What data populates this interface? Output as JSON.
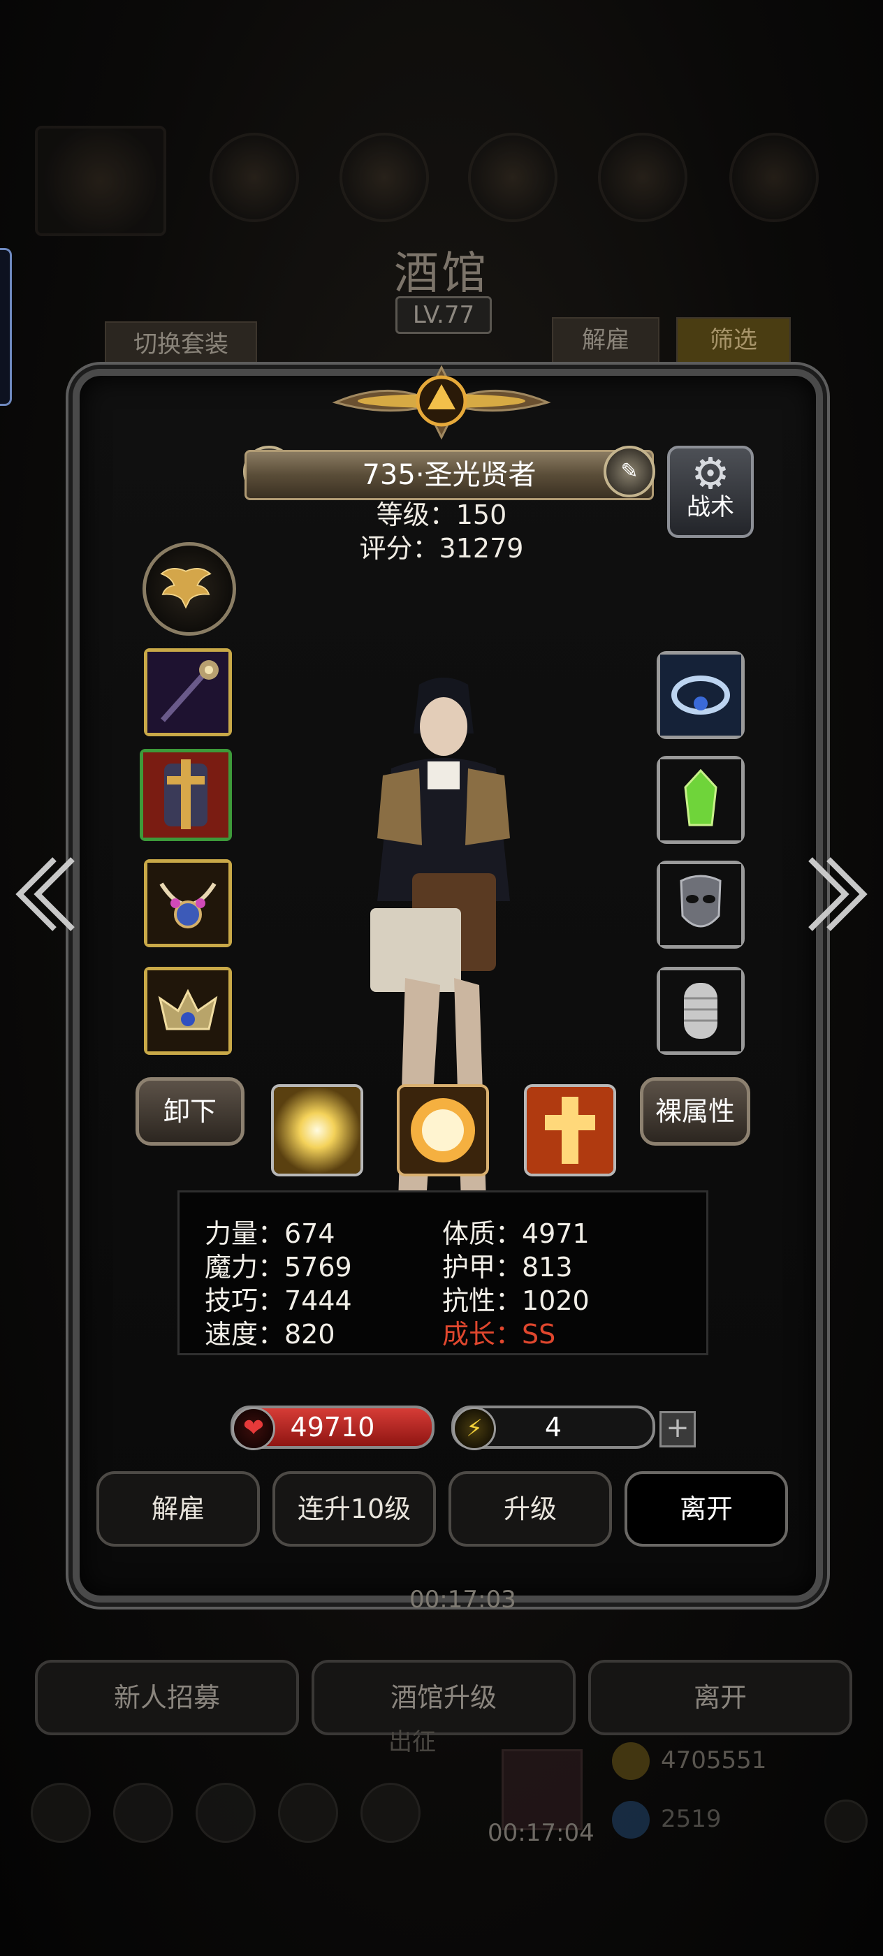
{
  "background": {
    "title": "酒馆",
    "level": "LV.77",
    "tab_switch": "切换套装",
    "tab_dismiss": "解雇",
    "tab_filter": "筛选",
    "timer_top": "00:17:03",
    "bottom_buttons": [
      "新人招募",
      "酒馆升级",
      "离开"
    ],
    "expedition": "出征",
    "timer_bottom": "00:17:04",
    "gold": "4705551",
    "gems": "2519"
  },
  "hero": {
    "name": "735·圣光贤者",
    "level_text": "等级：150",
    "score_text": "评分：31279",
    "tactics_label": "战术",
    "unequip_label": "卸下",
    "base_attr_label": "裸属性"
  },
  "stats": {
    "strength": "力量：674",
    "magic": "魔力：5769",
    "skill": "技巧：7444",
    "speed": "速度：820",
    "constitution": "体质：4971",
    "armor": "护甲：813",
    "resistance": "抗性：1020",
    "growth": "成长：SS"
  },
  "resources": {
    "hp": "49710",
    "energy": "4",
    "plus": "+"
  },
  "actions": {
    "dismiss": "解雇",
    "level_up_10": "连升10级",
    "level_up": "升级",
    "leave": "离开"
  },
  "icons": {
    "left_slots": [
      "staff-icon",
      "holy-armor-icon",
      "jeweled-necklace-icon",
      "winged-crown-icon"
    ],
    "right_slots": [
      "blue-ring-icon",
      "green-crystal-icon",
      "mask-icon",
      "chainmail-icon"
    ],
    "skills": [
      "golden-burst-icon",
      "holy-orb-icon",
      "holy-cross-icon"
    ]
  },
  "colors": {
    "gold_border": "#c9a948",
    "hp_red": "#d63c36",
    "growth_red": "#e0472e"
  }
}
